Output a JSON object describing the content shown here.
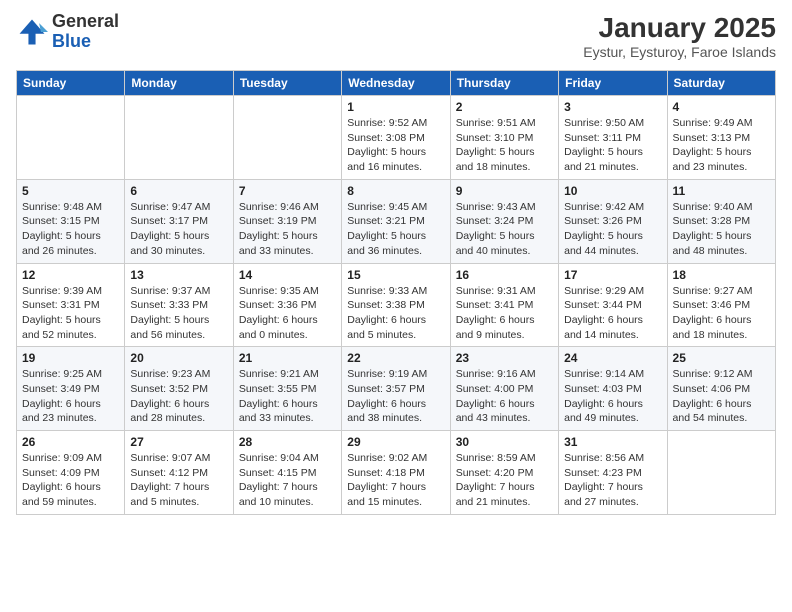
{
  "header": {
    "logo_general": "General",
    "logo_blue": "Blue",
    "month_title": "January 2025",
    "location": "Eystur, Eysturoy, Faroe Islands"
  },
  "weekdays": [
    "Sunday",
    "Monday",
    "Tuesday",
    "Wednesday",
    "Thursday",
    "Friday",
    "Saturday"
  ],
  "weeks": [
    [
      {
        "day": "",
        "info": ""
      },
      {
        "day": "",
        "info": ""
      },
      {
        "day": "",
        "info": ""
      },
      {
        "day": "1",
        "info": "Sunrise: 9:52 AM\nSunset: 3:08 PM\nDaylight: 5 hours and 16 minutes."
      },
      {
        "day": "2",
        "info": "Sunrise: 9:51 AM\nSunset: 3:10 PM\nDaylight: 5 hours and 18 minutes."
      },
      {
        "day": "3",
        "info": "Sunrise: 9:50 AM\nSunset: 3:11 PM\nDaylight: 5 hours and 21 minutes."
      },
      {
        "day": "4",
        "info": "Sunrise: 9:49 AM\nSunset: 3:13 PM\nDaylight: 5 hours and 23 minutes."
      }
    ],
    [
      {
        "day": "5",
        "info": "Sunrise: 9:48 AM\nSunset: 3:15 PM\nDaylight: 5 hours and 26 minutes."
      },
      {
        "day": "6",
        "info": "Sunrise: 9:47 AM\nSunset: 3:17 PM\nDaylight: 5 hours and 30 minutes."
      },
      {
        "day": "7",
        "info": "Sunrise: 9:46 AM\nSunset: 3:19 PM\nDaylight: 5 hours and 33 minutes."
      },
      {
        "day": "8",
        "info": "Sunrise: 9:45 AM\nSunset: 3:21 PM\nDaylight: 5 hours and 36 minutes."
      },
      {
        "day": "9",
        "info": "Sunrise: 9:43 AM\nSunset: 3:24 PM\nDaylight: 5 hours and 40 minutes."
      },
      {
        "day": "10",
        "info": "Sunrise: 9:42 AM\nSunset: 3:26 PM\nDaylight: 5 hours and 44 minutes."
      },
      {
        "day": "11",
        "info": "Sunrise: 9:40 AM\nSunset: 3:28 PM\nDaylight: 5 hours and 48 minutes."
      }
    ],
    [
      {
        "day": "12",
        "info": "Sunrise: 9:39 AM\nSunset: 3:31 PM\nDaylight: 5 hours and 52 minutes."
      },
      {
        "day": "13",
        "info": "Sunrise: 9:37 AM\nSunset: 3:33 PM\nDaylight: 5 hours and 56 minutes."
      },
      {
        "day": "14",
        "info": "Sunrise: 9:35 AM\nSunset: 3:36 PM\nDaylight: 6 hours and 0 minutes."
      },
      {
        "day": "15",
        "info": "Sunrise: 9:33 AM\nSunset: 3:38 PM\nDaylight: 6 hours and 5 minutes."
      },
      {
        "day": "16",
        "info": "Sunrise: 9:31 AM\nSunset: 3:41 PM\nDaylight: 6 hours and 9 minutes."
      },
      {
        "day": "17",
        "info": "Sunrise: 9:29 AM\nSunset: 3:44 PM\nDaylight: 6 hours and 14 minutes."
      },
      {
        "day": "18",
        "info": "Sunrise: 9:27 AM\nSunset: 3:46 PM\nDaylight: 6 hours and 18 minutes."
      }
    ],
    [
      {
        "day": "19",
        "info": "Sunrise: 9:25 AM\nSunset: 3:49 PM\nDaylight: 6 hours and 23 minutes."
      },
      {
        "day": "20",
        "info": "Sunrise: 9:23 AM\nSunset: 3:52 PM\nDaylight: 6 hours and 28 minutes."
      },
      {
        "day": "21",
        "info": "Sunrise: 9:21 AM\nSunset: 3:55 PM\nDaylight: 6 hours and 33 minutes."
      },
      {
        "day": "22",
        "info": "Sunrise: 9:19 AM\nSunset: 3:57 PM\nDaylight: 6 hours and 38 minutes."
      },
      {
        "day": "23",
        "info": "Sunrise: 9:16 AM\nSunset: 4:00 PM\nDaylight: 6 hours and 43 minutes."
      },
      {
        "day": "24",
        "info": "Sunrise: 9:14 AM\nSunset: 4:03 PM\nDaylight: 6 hours and 49 minutes."
      },
      {
        "day": "25",
        "info": "Sunrise: 9:12 AM\nSunset: 4:06 PM\nDaylight: 6 hours and 54 minutes."
      }
    ],
    [
      {
        "day": "26",
        "info": "Sunrise: 9:09 AM\nSunset: 4:09 PM\nDaylight: 6 hours and 59 minutes."
      },
      {
        "day": "27",
        "info": "Sunrise: 9:07 AM\nSunset: 4:12 PM\nDaylight: 7 hours and 5 minutes."
      },
      {
        "day": "28",
        "info": "Sunrise: 9:04 AM\nSunset: 4:15 PM\nDaylight: 7 hours and 10 minutes."
      },
      {
        "day": "29",
        "info": "Sunrise: 9:02 AM\nSunset: 4:18 PM\nDaylight: 7 hours and 15 minutes."
      },
      {
        "day": "30",
        "info": "Sunrise: 8:59 AM\nSunset: 4:20 PM\nDaylight: 7 hours and 21 minutes."
      },
      {
        "day": "31",
        "info": "Sunrise: 8:56 AM\nSunset: 4:23 PM\nDaylight: 7 hours and 27 minutes."
      },
      {
        "day": "",
        "info": ""
      }
    ]
  ]
}
